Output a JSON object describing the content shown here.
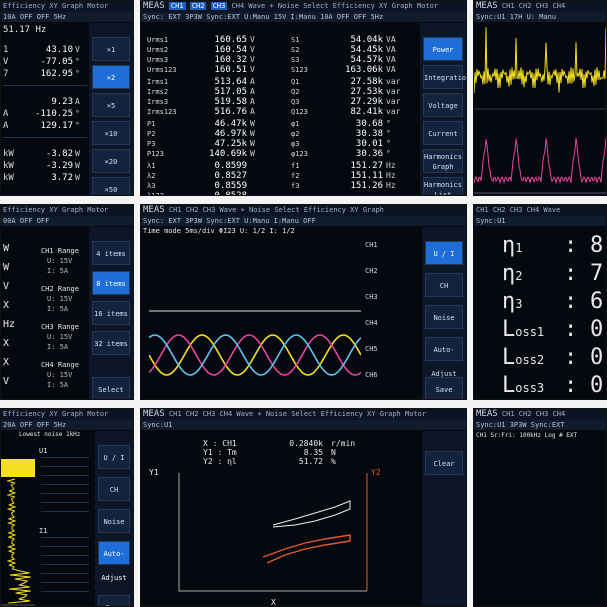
{
  "p1": {
    "tabs": "Efficiency  XY Graph  Motor",
    "info": "10A  OFF  OFF  5Hz",
    "freq": "51.17 Hz",
    "rows": [
      {
        "l": "1",
        "v": "43.10",
        "u": "V"
      },
      {
        "l": "V",
        "v": "-77.05",
        "u": "°"
      },
      {
        "l": "7",
        "v": "162.95",
        "u": "°"
      },
      {
        "l": "",
        "v": "9.23",
        "u": "A"
      },
      {
        "l": "A",
        "v": "-110.25",
        "u": "°"
      },
      {
        "l": "A",
        "v": "129.17",
        "u": "°"
      },
      {
        "l": "kW",
        "v": "-3.82",
        "u": "W"
      },
      {
        "l": "kW",
        "v": "-3.29",
        "u": "W"
      },
      {
        "l": "kW",
        "v": "3.72",
        "u": "W"
      }
    ],
    "buttons": [
      "×1",
      "×2",
      "×5",
      "×10",
      "×20",
      "×50"
    ]
  },
  "p2": {
    "logo": "MEAS",
    "ch": [
      "CH1",
      "CH2",
      "CH3",
      "CH4"
    ],
    "tabs": "Wave + Noise  Select  Efficiency  XY Graph  Motor",
    "info": "Sync: EXT  3P3W  Sync:EXT  U:Manu  15V  I:Manu  10A  OFF  OFF  5Hz",
    "left": [
      {
        "l": "Urms1",
        "v": "160.65",
        "u": "V"
      },
      {
        "l": "Urms2",
        "v": "160.54",
        "u": "V"
      },
      {
        "l": "Urms3",
        "v": "160.32",
        "u": "V"
      },
      {
        "l": "Urms123",
        "v": "160.51",
        "u": "V"
      },
      {
        "l": "Irms1",
        "v": "513.64",
        "u": "A"
      },
      {
        "l": "Irms2",
        "v": "517.05",
        "u": "A"
      },
      {
        "l": "Irms3",
        "v": "519.58",
        "u": "A"
      },
      {
        "l": "Irms123",
        "v": "516.76",
        "u": "A"
      },
      {
        "l": "P1",
        "v": "46.47k",
        "u": "W"
      },
      {
        "l": "P2",
        "v": "46.97k",
        "u": "W"
      },
      {
        "l": "P3",
        "v": "47.25k",
        "u": "W"
      },
      {
        "l": "P123",
        "v": "140.69k",
        "u": "W"
      },
      {
        "l": "λ1",
        "v": "0.8599",
        "u": ""
      },
      {
        "l": "λ2",
        "v": "0.8527",
        "u": ""
      },
      {
        "l": "λ3",
        "v": "0.8559",
        "u": ""
      },
      {
        "l": "λ123",
        "v": "0.8528",
        "u": ""
      }
    ],
    "right": [
      {
        "l": "S1",
        "v": "54.04k",
        "u": "VA"
      },
      {
        "l": "S2",
        "v": "54.45k",
        "u": "VA"
      },
      {
        "l": "S3",
        "v": "54.57k",
        "u": "VA"
      },
      {
        "l": "S123",
        "v": "163.06k",
        "u": "VA"
      },
      {
        "l": "Q1",
        "v": "27.58k",
        "u": "var"
      },
      {
        "l": "Q2",
        "v": "27.53k",
        "u": "var"
      },
      {
        "l": "Q3",
        "v": "27.29k",
        "u": "var"
      },
      {
        "l": "Q123",
        "v": "82.41k",
        "u": "var"
      },
      {
        "l": "φ1",
        "v": "30.68",
        "u": "°"
      },
      {
        "l": "φ2",
        "v": "30.38",
        "u": "°"
      },
      {
        "l": "φ3",
        "v": "30.01",
        "u": "°"
      },
      {
        "l": "φ123",
        "v": "30.36",
        "u": "°"
      },
      {
        "l": "f1",
        "v": "151.27",
        "u": "Hz"
      },
      {
        "l": "f2",
        "v": "151.11",
        "u": "Hz"
      },
      {
        "l": "f3",
        "v": "151.26",
        "u": "Hz"
      }
    ],
    "buttons": [
      "Power",
      "Integration",
      "Voltage",
      "Current",
      "Harmonics Graph",
      "Harmonics List"
    ]
  },
  "p3": {
    "logo": "MEAS",
    "ch": [
      "CH1",
      "CH2",
      "CH3",
      "CH4"
    ],
    "info": "Sync:U1  17H  U: Manu"
  },
  "p4": {
    "tabs": "Efficiency  XY Graph  Motor",
    "info": "00A  OFF  OFF",
    "groups": [
      {
        "name": "CH1 Range",
        "a": "U: 15V",
        "b": "I: 5A"
      },
      {
        "name": "CH2 Range",
        "a": "U: 15V",
        "b": "I: 5A"
      },
      {
        "name": "CH3 Range",
        "a": "U: 15V",
        "b": "I: 5A"
      },
      {
        "name": "CH4 Range",
        "a": "U: 15V",
        "b": "I: 5A"
      }
    ],
    "left_letters": [
      "W",
      "W",
      "V",
      "X",
      "Hz",
      "X",
      "X",
      "V"
    ],
    "buttons": [
      "4 items",
      "8 items",
      "16 items",
      "32 items",
      "Select"
    ]
  },
  "p5": {
    "logo": "MEAS",
    "ch": [
      "CH1",
      "CH2",
      "CH3"
    ],
    "tabs": "Wave + Noise  Select  Efficiency  XY Graph",
    "info": "Sync: EXT  3P3W  Sync:EXT  U:Manu  I:Manu  OFF",
    "sub": "Time mode   5ms/div   ΦI23   U: 1/2  I: 1/2",
    "readouts": [
      "CH1",
      "CH2",
      "CH3",
      "CH4",
      "CH5",
      "CH6"
    ],
    "buttons": [
      "U / I",
      "CH",
      "Noise",
      "Auto-Adjust",
      "Save"
    ]
  },
  "p6": {
    "tabs": "CH1  CH2  CH3  CH4  Wave",
    "info": "Sync:U1",
    "rows": [
      {
        "l": "η",
        "s": "1",
        "v": "8"
      },
      {
        "l": "η",
        "s": "2",
        "v": "7"
      },
      {
        "l": "η",
        "s": "3",
        "v": "6"
      },
      {
        "l": "L",
        "s": "oss1",
        "v": "0."
      },
      {
        "l": "L",
        "s": "oss2",
        "v": "0."
      },
      {
        "l": "L",
        "s": "oss3",
        "v": "0."
      }
    ]
  },
  "p7": {
    "tabs": "Efficiency  XY Graph  Motor",
    "info": "20A  OFF  OFF  5Hz",
    "sub": "Lowest noise  1kHz",
    "tables": [
      "U1",
      "I1"
    ],
    "buttons": [
      "U / I",
      "CH",
      "Noise",
      "Auto-Adjust",
      "Save"
    ]
  },
  "p8": {
    "logo": "MEAS",
    "ch": [
      "CH1",
      "CH2",
      "CH3",
      "CH4"
    ],
    "tabs": "Wave + Noise  Select  Efficiency  XY Graph  Motor",
    "info": "Sync:U1",
    "readout": [
      {
        "l": "X : CH1",
        "v": "0.2840k",
        "u": "r/min"
      },
      {
        "l": "Y1 : Tm",
        "v": "8.35",
        "u": "N"
      },
      {
        "l": "Y2 : ηl",
        "v": "51.72",
        "u": "%"
      }
    ],
    "y1": "Y1",
    "y2": "Y2",
    "x": "X",
    "buttons": [
      "Clear"
    ]
  },
  "p9": {
    "logo": "MEAS",
    "ch": [
      "CH1",
      "CH2",
      "CH3",
      "CH4"
    ],
    "info": "Sync:U1  3P3W  Sync:EXT",
    "sub": "CH1  Sr:Fri: 100kHz  Log  # EXT"
  }
}
